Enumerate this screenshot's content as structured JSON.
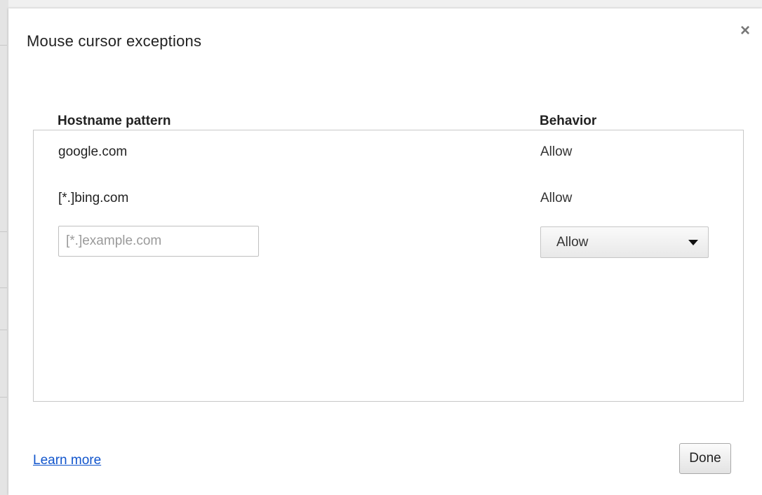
{
  "dialog": {
    "title": "Mouse cursor exceptions",
    "close_icon": "close-icon"
  },
  "table": {
    "headers": {
      "hostname": "Hostname pattern",
      "behavior": "Behavior"
    },
    "rows": [
      {
        "hostname": "google.com",
        "behavior": "Allow"
      },
      {
        "hostname": "[*.]bing.com",
        "behavior": "Allow"
      }
    ],
    "new_entry": {
      "hostname_value": "",
      "hostname_placeholder": "[*.]example.com",
      "behavior_selected": "Allow"
    }
  },
  "footer": {
    "learn_more": "Learn more",
    "done_label": "Done"
  }
}
